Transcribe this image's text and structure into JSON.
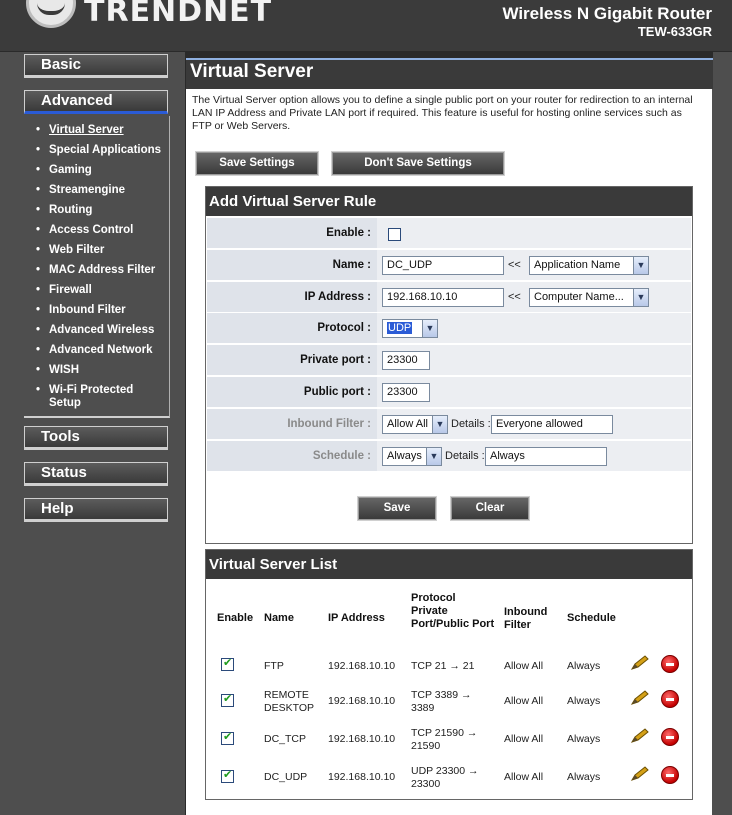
{
  "header": {
    "brand": "TRENDNET",
    "product": "Wireless N Gigabit Router",
    "model": "TEW-633GR"
  },
  "sidebar": {
    "basic": "Basic",
    "advanced": "Advanced",
    "tools": "Tools",
    "status": "Status",
    "help": "Help",
    "items": [
      "Virtual Server",
      "Special Applications",
      "Gaming",
      "Streamengine",
      "Routing",
      "Access Control",
      "Web Filter",
      "MAC Address Filter",
      "Firewall",
      "Inbound Filter",
      "Advanced Wireless",
      "Advanced Network",
      "WISH",
      "Wi-Fi Protected Setup"
    ]
  },
  "page": {
    "title": "Virtual Server",
    "description": "The Virtual Server option allows you to define a single public port on your router for redirection to an internal LAN IP Address and Private LAN port if required. This feature is useful for hosting online services such as FTP or Web Servers.",
    "save_settings": "Save Settings",
    "dont_save_settings": "Don't Save Settings"
  },
  "rule_form": {
    "title": "Add Virtual Server Rule",
    "enable_label": "Enable :",
    "name_label": "Name :",
    "name_value": "DC_UDP",
    "name_chevrons": "<<",
    "name_select": "Application Name",
    "ip_label": "IP Address :",
    "ip_value": "192.168.10.10",
    "ip_chevrons": "<<",
    "ip_select": "Computer Name...",
    "protocol_label": "Protocol :",
    "protocol_value": "UDP",
    "private_port_label": "Private port :",
    "private_port_value": "23300",
    "public_port_label": "Public port :",
    "public_port_value": "23300",
    "inbound_label": "Inbound Filter :",
    "inbound_select": "Allow All",
    "inbound_details_label": "Details :",
    "inbound_details_value": "Everyone allowed",
    "schedule_label": "Schedule :",
    "schedule_select": "Always",
    "schedule_details_label": "Details :",
    "schedule_details_value": "Always",
    "save": "Save",
    "clear": "Clear"
  },
  "server_list": {
    "title": "Virtual Server List",
    "headers": {
      "enable": "Enable",
      "name": "Name",
      "ip": "IP Address",
      "protocol": "Protocol Private Port/Public Port",
      "inbound": "Inbound Filter",
      "schedule": "Schedule"
    },
    "rows": [
      {
        "name": "FTP",
        "ip": "192.168.10.10",
        "ports": "TCP 21 → 21",
        "inbound": "Allow All",
        "schedule": "Always"
      },
      {
        "name": "REMOTE DESKTOP",
        "ip": "192.168.10.10",
        "ports": "TCP 3389 → 3389",
        "inbound": "Allow All",
        "schedule": "Always"
      },
      {
        "name": "DC_TCP",
        "ip": "192.168.10.10",
        "ports": "TCP 21590 → 21590",
        "inbound": "Allow All",
        "schedule": "Always"
      },
      {
        "name": "DC_UDP",
        "ip": "192.168.10.10",
        "ports": "UDP 23300 → 23300",
        "inbound": "Allow All",
        "schedule": "Always"
      }
    ]
  }
}
